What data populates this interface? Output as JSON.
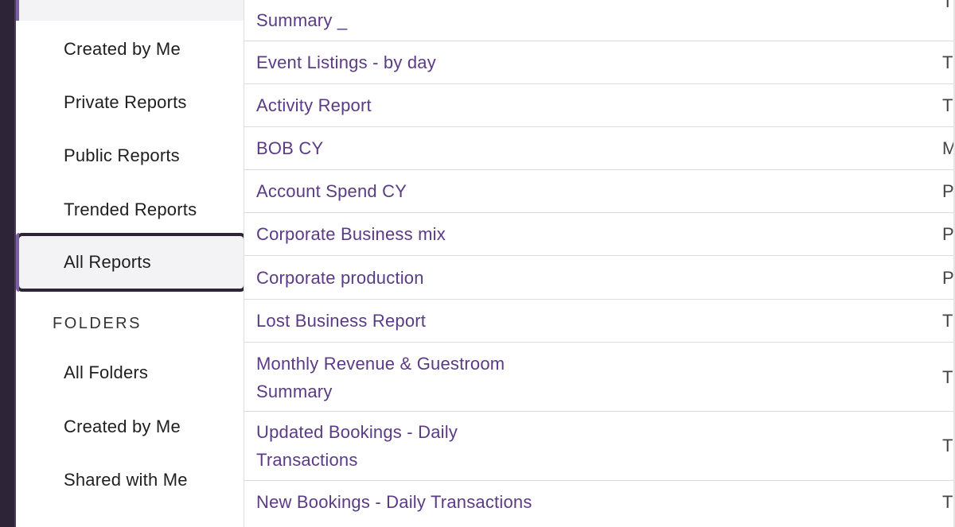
{
  "sidebar": {
    "items_top": [
      {
        "label": "Created by Me"
      },
      {
        "label": "Private Reports"
      },
      {
        "label": "Public Reports"
      },
      {
        "label": "Trended Reports"
      },
      {
        "label": "All Reports",
        "selected": true
      }
    ],
    "folders_heading": "FOLDERS",
    "folder_items": [
      {
        "label": "All Folders"
      },
      {
        "label": "Created by Me"
      },
      {
        "label": "Shared with Me"
      }
    ]
  },
  "reports": {
    "rows": [
      {
        "name": "Summary _",
        "type_initial": "T"
      },
      {
        "name": "Event Listings - by day",
        "type_initial": "T"
      },
      {
        "name": "Activity Report",
        "type_initial": "T"
      },
      {
        "name": "BOB CY",
        "type_initial": "M"
      },
      {
        "name": "Account Spend CY",
        "type_initial": "P"
      },
      {
        "name": "Corporate Business mix",
        "type_initial": "P"
      },
      {
        "name": "Corporate production",
        "type_initial": "P"
      },
      {
        "name": "Lost Business Report",
        "type_initial": "T"
      },
      {
        "name": "Monthly Revenue & Guestroom Summary",
        "type_initial": "T"
      },
      {
        "name": "Updated Bookings - Daily Transactions",
        "type_initial": "T"
      },
      {
        "name": "New Bookings - Daily Transactions",
        "type_initial": "T"
      }
    ]
  },
  "colors": {
    "accent": "#5b3a86",
    "rail": "#2d2437",
    "selected_bg": "#f3f2f5"
  }
}
